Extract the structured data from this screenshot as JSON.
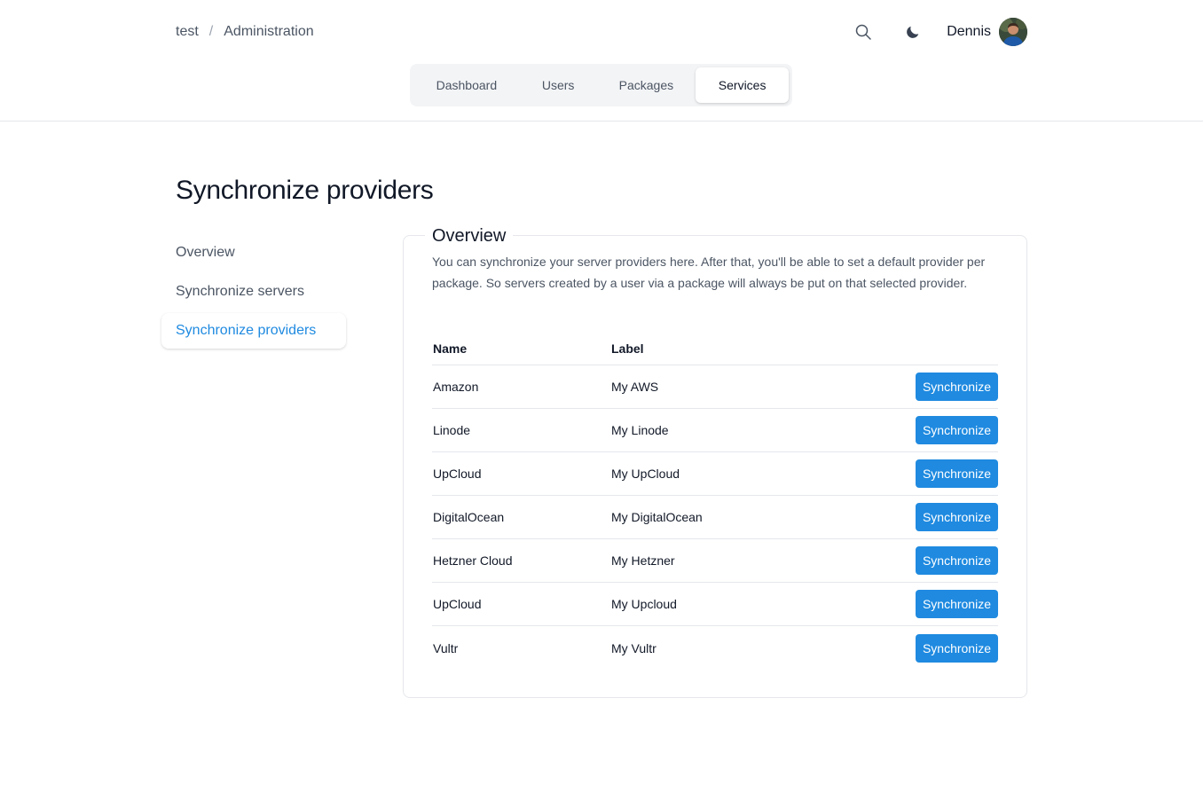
{
  "breadcrumb": {
    "root": "test",
    "separator": "/",
    "current": "Administration"
  },
  "header": {
    "user_name": "Dennis",
    "search_icon": "search-icon",
    "theme_icon": "moon-icon"
  },
  "tabs": [
    {
      "label": "Dashboard",
      "active": false
    },
    {
      "label": "Users",
      "active": false
    },
    {
      "label": "Packages",
      "active": false
    },
    {
      "label": "Services",
      "active": true
    }
  ],
  "page": {
    "title": "Synchronize providers"
  },
  "side_nav": [
    {
      "label": "Overview",
      "active": false
    },
    {
      "label": "Synchronize servers",
      "active": false
    },
    {
      "label": "Synchronize providers",
      "active": true
    }
  ],
  "card": {
    "legend": "Overview",
    "description": "You can synchronize your server providers here. After that, you'll be able to set a default provider per package. So servers created by a user via a package will always be put on that selected provider.",
    "table": {
      "headers": {
        "name": "Name",
        "label": "Label"
      },
      "rows": [
        {
          "name": "Amazon",
          "label": "My AWS",
          "action": "Synchronize"
        },
        {
          "name": "Linode",
          "label": "My Linode",
          "action": "Synchronize"
        },
        {
          "name": "UpCloud",
          "label": "My UpCloud",
          "action": "Synchronize"
        },
        {
          "name": "DigitalOcean",
          "label": "My DigitalOcean",
          "action": "Synchronize"
        },
        {
          "name": "Hetzner Cloud",
          "label": "My Hetzner",
          "action": "Synchronize"
        },
        {
          "name": "UpCloud",
          "label": "My Upcloud",
          "action": "Synchronize"
        },
        {
          "name": "Vultr",
          "label": "My Vultr",
          "action": "Synchronize"
        }
      ]
    }
  },
  "colors": {
    "accent": "#1f8ae0",
    "border": "#e5e7eb",
    "muted_text": "#4b5563"
  }
}
